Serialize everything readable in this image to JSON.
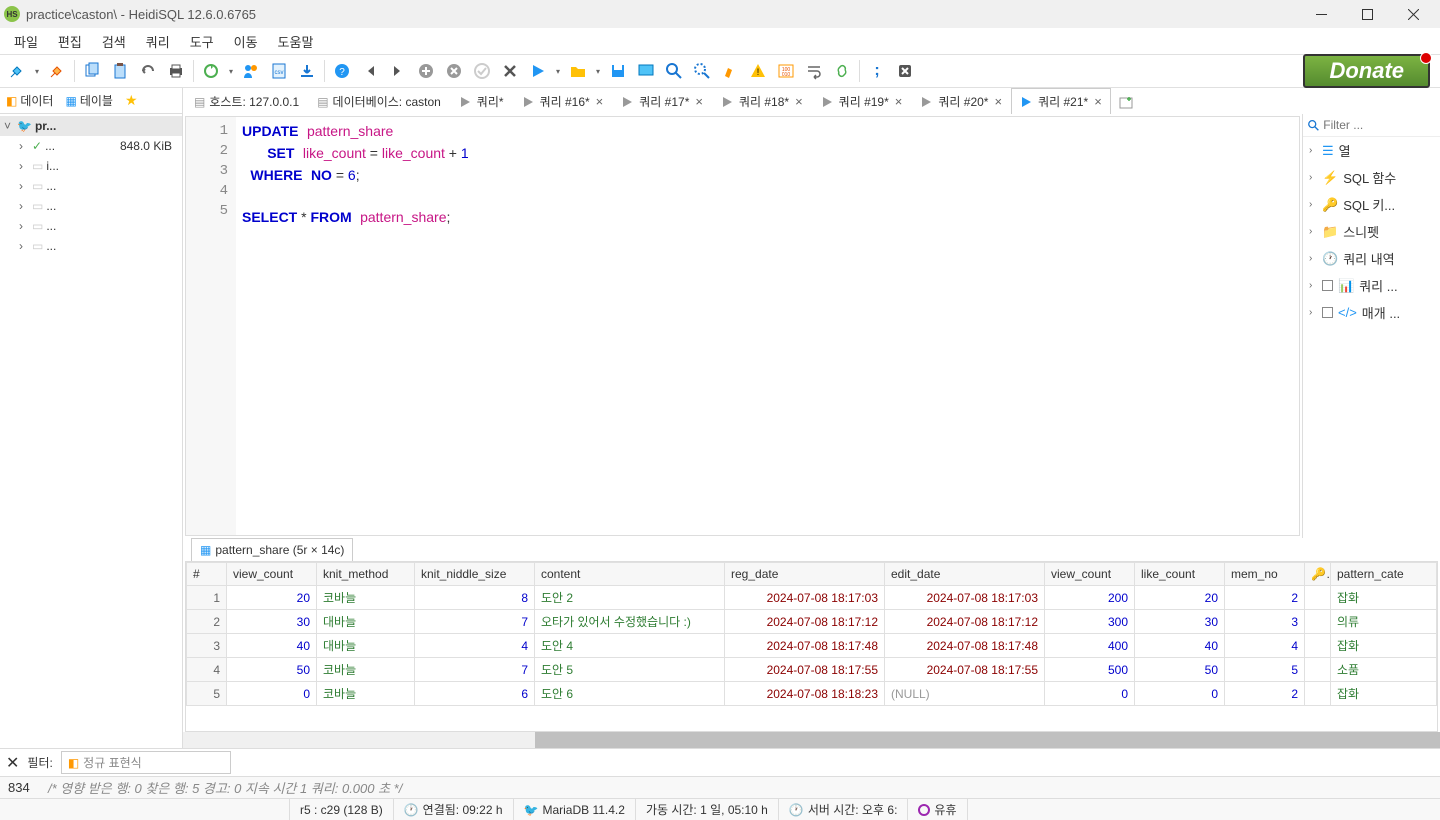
{
  "window_title": "practice\\caston\\ - HeidiSQL 12.6.0.6765",
  "menubar": [
    "파일",
    "편집",
    "검색",
    "쿼리",
    "도구",
    "이동",
    "도움말"
  ],
  "donate": "Donate",
  "sidetabs": {
    "t1": "데이터",
    "t2": "테이블"
  },
  "tree": {
    "root": "pr...",
    "size": "848.0 KiB",
    "children": [
      "...",
      "i...",
      "...",
      "...",
      "...",
      "..."
    ]
  },
  "edtabs": {
    "host": "호스트: 127.0.0.1",
    "db": "데이터베이스: caston",
    "q": "쿼리*",
    "q16": "쿼리 #16*",
    "q17": "쿼리 #17*",
    "q18": "쿼리 #18*",
    "q19": "쿼리 #19*",
    "q20": "쿼리 #20*",
    "q21": "쿼리 #21*"
  },
  "code": {
    "l1_kw1": "UPDATE",
    "l1_id": "pattern_share",
    "l2_kw1": "SET",
    "l2_id1": "like_count",
    "l2_op": " = ",
    "l2_id2": "like_count",
    "l2_plus": " + ",
    "l2_n": "1",
    "l3_kw1": "WHERE",
    "l3_kw2": "NO",
    "l3_eq": " = ",
    "l3_n": "6",
    "l3_sc": ";",
    "l5_kw1": "SELECT",
    "l5_star": " * ",
    "l5_kw2": "FROM",
    "l5_id": "pattern_share",
    "l5_sc": ";"
  },
  "results_tab": "pattern_share (5r × 14c)",
  "cols": [
    "#",
    "view_count",
    "knit_method",
    "knit_niddle_size",
    "content",
    "reg_date",
    "edit_date",
    "view_count",
    "like_count",
    "mem_no",
    "",
    "pattern_cate"
  ],
  "rows": [
    {
      "n": "1",
      "vc": "20",
      "km": "코바늘",
      "kns": "8",
      "ct": "도안 2",
      "rd": "2024-07-08 18:17:03",
      "ed": "2024-07-08 18:17:03",
      "vc2": "200",
      "lc": "20",
      "mn": "2",
      "pc": "잡화"
    },
    {
      "n": "2",
      "vc": "30",
      "km": "대바늘",
      "kns": "7",
      "ct": "오타가 있어서 수정했습니다 :)",
      "rd": "2024-07-08 18:17:12",
      "ed": "2024-07-08 18:17:12",
      "vc2": "300",
      "lc": "30",
      "mn": "3",
      "pc": "의류"
    },
    {
      "n": "3",
      "vc": "40",
      "km": "대바늘",
      "kns": "4",
      "ct": "도안 4",
      "rd": "2024-07-08 18:17:48",
      "ed": "2024-07-08 18:17:48",
      "vc2": "400",
      "lc": "40",
      "mn": "4",
      "pc": "잡화"
    },
    {
      "n": "4",
      "vc": "50",
      "km": "코바늘",
      "kns": "7",
      "ct": "도안 5",
      "rd": "2024-07-08 18:17:55",
      "ed": "2024-07-08 18:17:55",
      "vc2": "500",
      "lc": "50",
      "mn": "5",
      "pc": "소품"
    },
    {
      "n": "5",
      "vc": "0",
      "km": "코바늘",
      "kns": "6",
      "ct": "도안 6",
      "rd": "2024-07-08 18:18:23",
      "ed": "(NULL)",
      "vc2": "0",
      "lc": "0",
      "mn": "2",
      "pc": "잡화"
    }
  ],
  "rightpanel": {
    "filter_ph": "Filter ...",
    "items": [
      "열",
      "SQL 함수",
      "SQL 키...",
      "스니펫",
      "쿼리 내역",
      "쿼리 ...",
      "매개 ..."
    ]
  },
  "filterbar": {
    "label": "필터:",
    "ph": "정규 표현식"
  },
  "status1": {
    "linenum": "834",
    "msg": "/* 영향 받은 행: 0  찾은 행: 5  경고: 0  지속 시간 1 쿼리: 0.000 초 */"
  },
  "status2": {
    "pos": "r5 : c29 (128 B)",
    "conn": "연결됨: 09:22 h",
    "server": "MariaDB 11.4.2",
    "uptime": "가동 시간: 1 일, 05:10 h",
    "time": "서버 시간: 오후 6:",
    "idle": "유휴"
  }
}
